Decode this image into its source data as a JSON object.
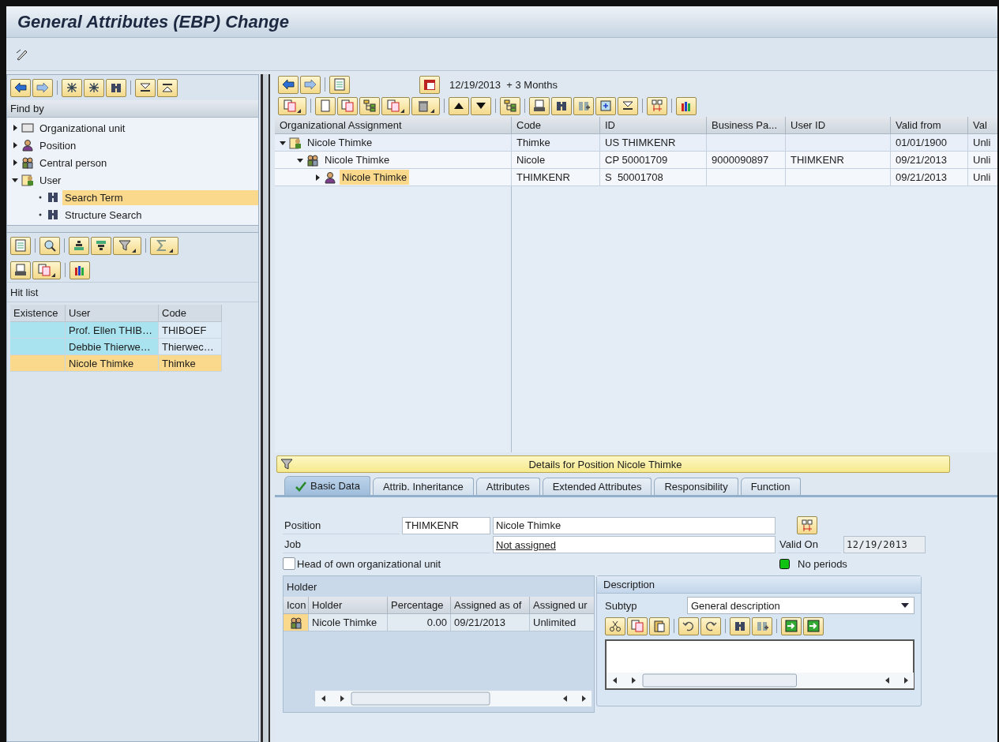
{
  "window": {
    "title": "General Attributes (EBP) Change"
  },
  "find_by": {
    "title": "Find by",
    "items": [
      {
        "label": "Organizational unit",
        "kind": "orgunit",
        "expanded": false,
        "selected": false
      },
      {
        "label": "Position",
        "kind": "position",
        "expanded": false,
        "selected": false
      },
      {
        "label": "Central person",
        "kind": "central_person",
        "expanded": false,
        "selected": false
      },
      {
        "label": "User",
        "kind": "user",
        "expanded": true,
        "selected": false,
        "children": [
          {
            "label": "Search Term",
            "kind": "search",
            "selected": true
          },
          {
            "label": "Structure Search",
            "kind": "search",
            "selected": false
          }
        ]
      }
    ]
  },
  "hit_list": {
    "title": "Hit list",
    "columns": [
      "Existence",
      "User",
      "Code"
    ],
    "rows": [
      {
        "user": "Prof. Ellen THIB…",
        "code": "THIBOEF",
        "selected": false
      },
      {
        "user": "Debbie Thierwe…",
        "code": "Thierwec…",
        "selected": false
      },
      {
        "user": "Nicole Thimke",
        "code": "Thimke",
        "selected": true
      }
    ]
  },
  "assignment": {
    "key_date": "12/19/2013  + 3 Months",
    "columns": [
      "Organizational Assignment",
      "Code",
      "ID",
      "Business Pa...",
      "User ID",
      "Valid from",
      "Val"
    ],
    "rows": [
      {
        "name": "Nicole Thimke",
        "kind": "user",
        "expanded": true,
        "selected": false,
        "code": "Thimke",
        "id": "US THIMKENR",
        "valid_from": "01/01/1900",
        "column_7": "Unli",
        "children": [
          {
            "name": "Nicole Thimke",
            "kind": "central_person",
            "expanded": true,
            "selected": false,
            "code": "Nicole",
            "id": "CP 50001709",
            "business_partner": "9000090897",
            "user_id": "THIMKENR",
            "valid_from": "09/21/2013",
            "column_7": "Unli",
            "children": [
              {
                "name": "Nicole Thimke",
                "kind": "position",
                "expanded": false,
                "selected": true,
                "code": "THIMKENR",
                "id": "S  50001708",
                "valid_from": "09/21/2013",
                "column_7": "Unli"
              }
            ]
          }
        ]
      }
    ]
  },
  "details": {
    "title": "Details for Position Nicole Thimke",
    "tabs": [
      {
        "label": "Basic Data",
        "selected": true
      },
      {
        "label": "Attrib. Inheritance",
        "selected": false
      },
      {
        "label": "Attributes",
        "selected": false
      },
      {
        "label": "Extended Attributes",
        "selected": false
      },
      {
        "label": "Responsibility",
        "selected": false
      },
      {
        "label": "Function",
        "selected": false
      }
    ],
    "position_label": "Position",
    "position_code": "THIMKENR",
    "position_name": "Nicole Thimke",
    "job_label": "Job",
    "job": "Not assigned",
    "valid_on_label": "Valid On",
    "valid_on": "12/19/2013",
    "head_checkbox": {
      "label": "Head of own organizational unit",
      "checked": false
    },
    "status": "No periods",
    "holder": {
      "title": "Holder",
      "columns": [
        "Icon",
        "Holder",
        "Percentage",
        "Assigned as of",
        "Assigned ur"
      ],
      "rows": [
        {
          "holder": "Nicole Thimke",
          "percentage": "0.00",
          "assigned_as_of": "09/21/2013",
          "assigned_until": "Unlimited"
        }
      ]
    },
    "description": {
      "title": "Description",
      "subtype_label": "Subtyp",
      "subtype": "General description"
    }
  }
}
